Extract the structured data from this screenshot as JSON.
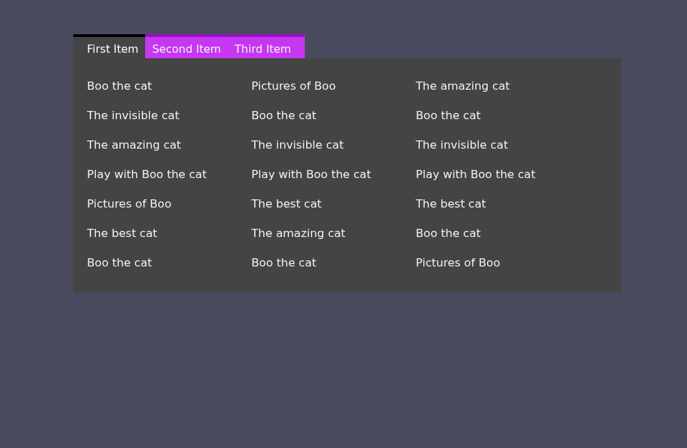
{
  "tabs": [
    {
      "label": "First Item",
      "selected": true
    },
    {
      "label": "Second Item",
      "selected": false
    },
    {
      "label": "Third Item",
      "selected": false
    }
  ],
  "columns": [
    {
      "items": [
        "Boo the cat",
        "The invisible cat",
        "The amazing cat",
        "Play with Boo the cat",
        "Pictures of Boo",
        "The best cat",
        "Boo the cat"
      ]
    },
    {
      "items": [
        "Pictures of Boo",
        "Boo the cat",
        "The invisible cat",
        "Play with Boo the cat",
        "The best cat",
        "The amazing cat",
        "Boo the cat"
      ]
    },
    {
      "items": [
        "The amazing cat",
        "Boo the cat",
        "The invisible cat",
        "Play with Boo the cat",
        "The best cat",
        "Boo the cat",
        "Pictures of Boo"
      ]
    }
  ]
}
